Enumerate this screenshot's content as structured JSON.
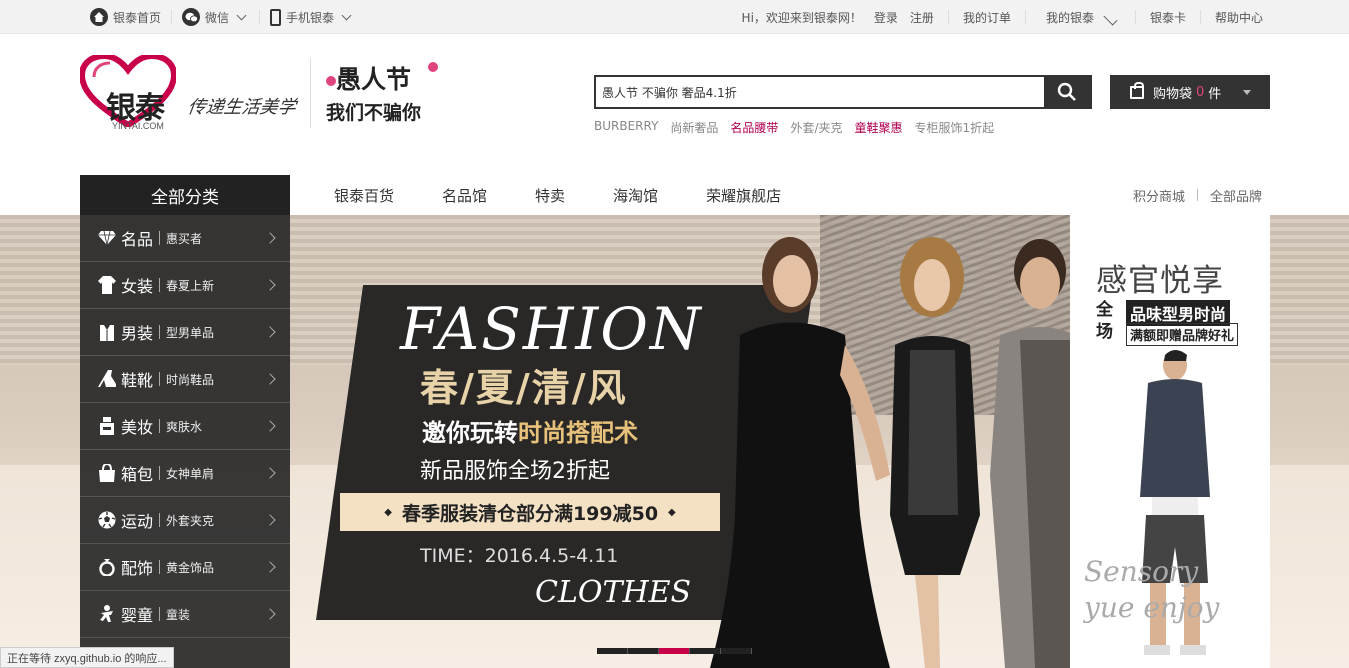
{
  "topbar": {
    "home_label": "银泰首页",
    "wechat_label": "微信",
    "mobile_label": "手机银泰",
    "greeting": "Hi，欢迎来到银泰网！",
    "login": "登录",
    "register": "注册",
    "my_orders": "我的订单",
    "my_yintai": "我的银泰",
    "yintai_card": "银泰卡",
    "help_center": "帮助中心"
  },
  "logo": {
    "brand": "银泰",
    "sub": "YINTAI.COM",
    "slogan": "传递生活美学"
  },
  "promo": {
    "line1": "愚人节",
    "line2": "我们不骗你"
  },
  "search": {
    "value": "愚人节 不骗你 奢品4.1折",
    "hotwords": [
      "BURBERRY",
      "尚新奢品",
      "名品腰带",
      "外套/夹克",
      "童鞋聚惠",
      "专柜服饰1折起"
    ]
  },
  "cart": {
    "label": "购物袋",
    "count": "0",
    "unit": "件"
  },
  "nav": {
    "all_categories": "全部分类",
    "items": [
      "银泰百货",
      "名品馆",
      "特卖",
      "海淘馆",
      "荣耀旗舰店"
    ],
    "points_mall": "积分商城",
    "all_brands": "全部品牌"
  },
  "categories": [
    {
      "label": "名品",
      "sub": "惠买者",
      "icon": "diamond-icon"
    },
    {
      "label": "女装",
      "sub": "春夏上新",
      "icon": "dress-icon"
    },
    {
      "label": "男装",
      "sub": "型男单品",
      "icon": "shirt-icon"
    },
    {
      "label": "鞋靴",
      "sub": "时尚鞋品",
      "icon": "heel-icon"
    },
    {
      "label": "美妆",
      "sub": "爽肤水",
      "icon": "cosmetic-icon"
    },
    {
      "label": "箱包",
      "sub": "女神单肩",
      "icon": "bag-icon"
    },
    {
      "label": "运动",
      "sub": "外套夹克",
      "icon": "ball-icon"
    },
    {
      "label": "配饰",
      "sub": "黄金饰品",
      "icon": "ring-icon"
    },
    {
      "label": "婴童",
      "sub": "童装",
      "icon": "baby-icon"
    }
  ],
  "banner": {
    "fashion": "FASHION",
    "headline": "春/夏/清/风",
    "tagline_a": "邀你玩转",
    "tagline_b": "时尚搭配术",
    "subline": "新品服饰全场2折起",
    "strip": "春季服装清仓部分满199减50",
    "time": "TIME：2016.4.5-4.11",
    "clothes": "CLOTHES"
  },
  "side_ad": {
    "title": "感官悦享",
    "prefix": "全场",
    "box1": "品味型男时尚",
    "box2": "满额即赠品牌好礼",
    "script1": "Sensory",
    "script2": "yue enjoy"
  },
  "status_text": "正在等待 zxyq.github.io 的响应...",
  "colors": {
    "accent": "#c8004a",
    "dark": "#333333",
    "hot": "#b0004f"
  }
}
